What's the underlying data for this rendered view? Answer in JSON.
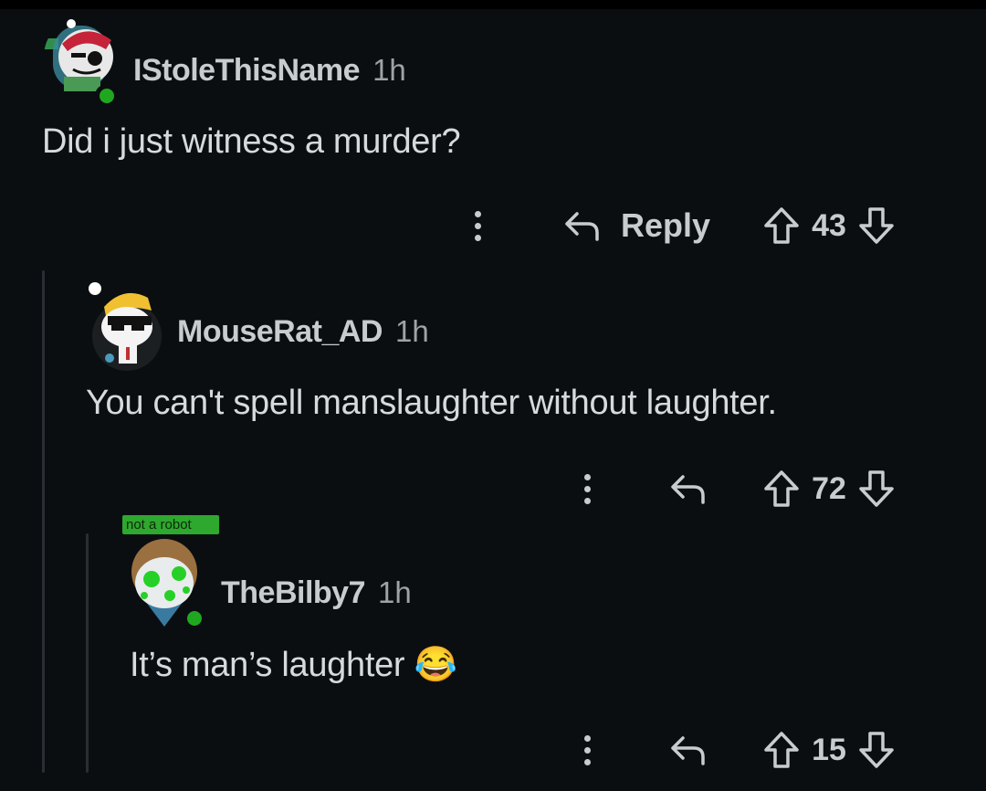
{
  "comments": [
    {
      "username": "IStoleThisName",
      "time": "1h",
      "body": "Did i just witness a murder?",
      "reply_label": "Reply",
      "votes": "43",
      "avatar_icon": "pirate-snoo-avatar",
      "online": true
    },
    {
      "username": "MouseRat_AD",
      "time": "1h",
      "body": "You can't spell manslaughter without laughter.",
      "votes": "72",
      "avatar_icon": "sunglasses-snoo-avatar"
    },
    {
      "username": "TheBilby7",
      "time": "1h",
      "badge": "not a robot",
      "body": "It’s man’s laughter",
      "emoji": "😂",
      "votes": "15",
      "avatar_icon": "green-splat-snoo-avatar",
      "online": true
    }
  ],
  "colors": {
    "background": "#0b0e11",
    "text": "#d7dadc",
    "online": "#1fa81f",
    "badge": "#2ea82e"
  }
}
